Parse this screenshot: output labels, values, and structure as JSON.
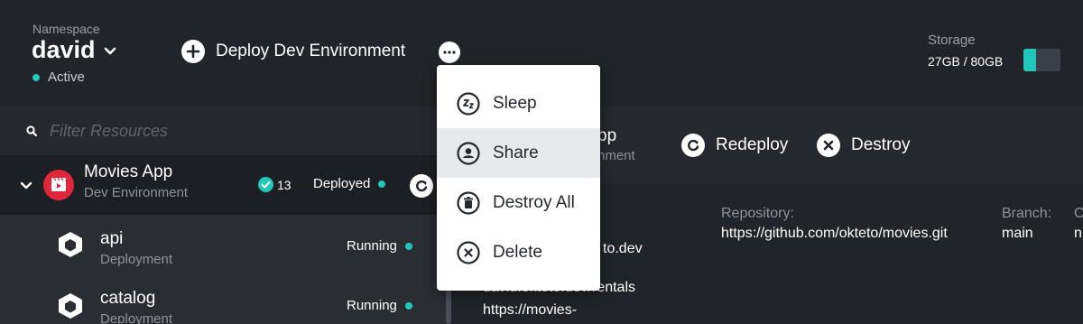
{
  "namespace": {
    "label": "Namespace",
    "name": "david",
    "status": "Active"
  },
  "header": {
    "deploy_label": "Deploy Dev Environment"
  },
  "storage": {
    "label": "Storage",
    "value": "27GB / 80GB",
    "used_fraction": 0.34
  },
  "filter": {
    "placeholder": "Filter Resources"
  },
  "app": {
    "title": "Movies App",
    "subtitle": "Dev Environment",
    "count": "13",
    "status": "Deployed"
  },
  "resources": [
    {
      "title": "api",
      "subtitle": "Deployment",
      "status": "Running"
    },
    {
      "title": "catalog",
      "subtitle": "Deployment",
      "status": "Running"
    }
  ],
  "main": {
    "title_partial": "pp",
    "subtitle_partial": "nment",
    "redeploy_label": "Redeploy",
    "destroy_label": "Destroy",
    "repository_label": "Repository:",
    "repository_value": "https://github.com/okteto/movies.git",
    "branch_label": "Branch:",
    "branch_value": "main",
    "extra_label_partial": "C",
    "extra_value_partial": "n",
    "endpoint1_partial": "to.dev",
    "endpoint2_partial": "david.okteto.dev/rentals",
    "endpoint3_partial": "https://movies-"
  },
  "menu": {
    "items": [
      {
        "label": "Sleep",
        "icon": "sleep-icon"
      },
      {
        "label": "Share",
        "icon": "user-icon"
      },
      {
        "label": "Destroy All",
        "icon": "trash-icon"
      },
      {
        "label": "Delete",
        "icon": "close-circle-icon"
      }
    ],
    "highlighted_index": 1
  },
  "colors": {
    "accent": "#21c7b8",
    "app_icon": "#e0263a",
    "background": "#212428"
  }
}
